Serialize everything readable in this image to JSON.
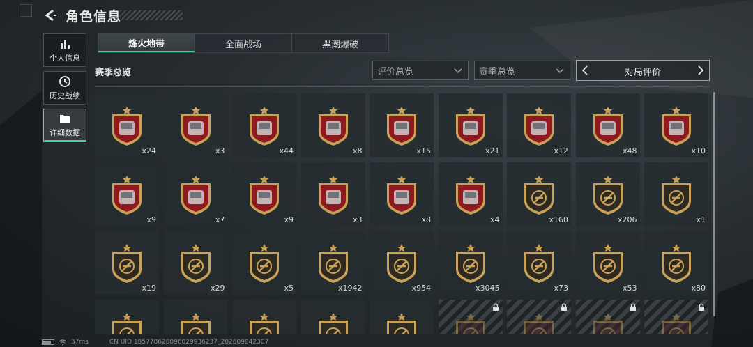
{
  "header": {
    "title": "角色信息"
  },
  "nav": [
    {
      "label": "个人信息",
      "icon": "bar-chart-icon",
      "active": false
    },
    {
      "label": "历史战绩",
      "icon": "history-icon",
      "active": false
    },
    {
      "label": "详细数据",
      "icon": "folder-icon",
      "active": true
    }
  ],
  "tabs": [
    {
      "label": "烽火地带",
      "active": true
    },
    {
      "label": "全面战场",
      "active": false
    },
    {
      "label": "黑潮爆破",
      "active": false
    }
  ],
  "toolbar": {
    "section_title": "赛季总览",
    "filter1": "评价总览",
    "filter2": "赛季总览",
    "pager_label": "对局评价"
  },
  "colors": {
    "accent": "#3ed19a",
    "badge_red": "#8e1a1f",
    "badge_gold": "#c9a25a",
    "badge_dark": "#2e2a22"
  },
  "items": [
    {
      "kind": "red",
      "icon": "gem-icon",
      "count": "x24"
    },
    {
      "kind": "red",
      "icon": "orb-icon",
      "count": "x3"
    },
    {
      "kind": "red",
      "icon": "tank-icon",
      "count": "x44"
    },
    {
      "kind": "red",
      "icon": "computer-icon",
      "count": "x8"
    },
    {
      "kind": "red",
      "icon": "device-icon",
      "count": "x15"
    },
    {
      "kind": "red",
      "icon": "plate-icon",
      "count": "x21"
    },
    {
      "kind": "red",
      "icon": "server-icon",
      "count": "x12"
    },
    {
      "kind": "red",
      "icon": "circuit-icon",
      "count": "x48"
    },
    {
      "kind": "red",
      "icon": "machine-icon",
      "count": "x10"
    },
    {
      "kind": "red",
      "icon": "lantern-icon",
      "count": "x9"
    },
    {
      "kind": "red",
      "icon": "helmet-icon",
      "count": "x7"
    },
    {
      "kind": "red",
      "icon": "chessboard-icon",
      "count": "x9"
    },
    {
      "kind": "red",
      "icon": "drone-icon",
      "count": "x3"
    },
    {
      "kind": "red",
      "icon": "frame-icon",
      "count": "x8"
    },
    {
      "kind": "red",
      "icon": "statue-icon",
      "count": "x4"
    },
    {
      "kind": "gold",
      "icon": "crosshair-rifle-icon",
      "count": "x160"
    },
    {
      "kind": "gold",
      "icon": "crosshair-rifle-icon",
      "count": "x206"
    },
    {
      "kind": "gold",
      "icon": "crosshair-rifle-icon",
      "count": "x1"
    },
    {
      "kind": "gold",
      "icon": "shield-star-icon",
      "count": "x19"
    },
    {
      "kind": "gold",
      "icon": "shield-star-icon",
      "count": "x29"
    },
    {
      "kind": "gold",
      "icon": "shield-star-icon",
      "count": "x5"
    },
    {
      "kind": "gold",
      "icon": "shield-star-icon",
      "count": "x1942"
    },
    {
      "kind": "gold",
      "icon": "burst-icon",
      "count": "x954"
    },
    {
      "kind": "gold",
      "icon": "emblem-icon",
      "count": "x3045"
    },
    {
      "kind": "gold",
      "icon": "wreath-icon",
      "count": "x73"
    },
    {
      "kind": "gold",
      "icon": "soldier-icon",
      "count": "x53"
    },
    {
      "kind": "gold",
      "icon": "hood-icon",
      "count": "x80"
    },
    {
      "kind": "gold",
      "icon": "skull-icon",
      "count": ""
    },
    {
      "kind": "gold",
      "icon": "skull-icon",
      "count": ""
    },
    {
      "kind": "gold",
      "icon": "skull-icon",
      "count": ""
    },
    {
      "kind": "gold",
      "icon": "skull-icon",
      "count": ""
    },
    {
      "kind": "gold",
      "icon": "skull-icon",
      "count": ""
    },
    {
      "kind": "locked",
      "icon": "lock-icon",
      "count": ""
    },
    {
      "kind": "locked",
      "icon": "lock-icon",
      "count": ""
    },
    {
      "kind": "locked",
      "icon": "lock-icon",
      "count": ""
    },
    {
      "kind": "locked",
      "icon": "lock-icon",
      "count": ""
    }
  ],
  "footer": {
    "ping": "37ms",
    "uid": "CN UID 18577862809602993623​7_202609042307"
  }
}
